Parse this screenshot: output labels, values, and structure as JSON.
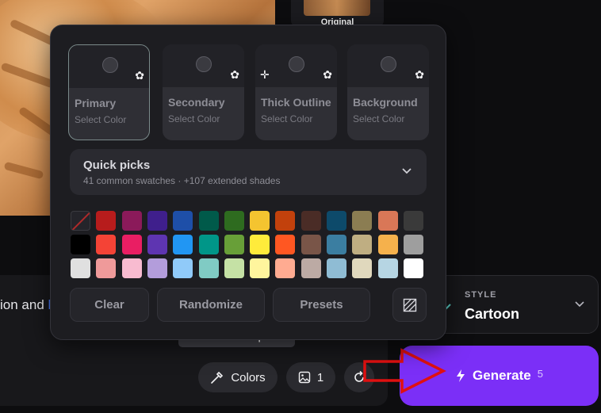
{
  "thumbnail": {
    "label": "Original"
  },
  "prompt": {
    "visible_text": "ion and ",
    "cursor_fragment": "l"
  },
  "palette": {
    "slots": [
      {
        "name": "Primary",
        "sub": "Select Color",
        "active": true
      },
      {
        "name": "Secondary",
        "sub": "Select Color",
        "active": false
      },
      {
        "name": "Thick Outline",
        "sub": "Select Color",
        "active": false
      },
      {
        "name": "Background",
        "sub": "Select Color",
        "active": false
      }
    ],
    "quick_picks": {
      "title": "Quick picks",
      "subtitle": "41 common swatches · +107 extended shades"
    },
    "swatch_rows": [
      [
        "none",
        "#b71c1c",
        "#8b1a5a",
        "#3f1f8c",
        "#1e4fa8",
        "#005a4a",
        "#2e6b1f",
        "#f4c430",
        "#c2410c",
        "#4a2c26",
        "#0d4a6a",
        "#8b7d52",
        "#d97757",
        "#3a3a3a"
      ],
      [
        "#000000",
        "#f44336",
        "#e91e63",
        "#5e35b1",
        "#2196f3",
        "#009688",
        "#689f38",
        "#ffeb3b",
        "#ff5722",
        "#795548",
        "#3b7ea1",
        "#bfae82",
        "#f5b14c",
        "#9e9e9e"
      ],
      [
        "#e0e0e0",
        "#ef9a9a",
        "#f8bbd0",
        "#b39ddb",
        "#90caf9",
        "#80cbc4",
        "#c5e1a5",
        "#fff59d",
        "#ffab91",
        "#bcaaa4",
        "#8fbcd4",
        "#e0d8bd",
        "#b6d5e3",
        "#ffffff"
      ]
    ],
    "actions": {
      "clear": "Clear",
      "randomize": "Randomize",
      "presets": "Presets"
    }
  },
  "tooltip": "Select the color palette",
  "toolbar": {
    "colors_label": "Colors",
    "image_count": "1"
  },
  "style": {
    "kicker": "STYLE",
    "value": "Cartoon"
  },
  "generate": {
    "label": "Generate",
    "count": "5"
  },
  "colors": {
    "accent": "#7b2ff7",
    "arrow": "#e01010"
  }
}
